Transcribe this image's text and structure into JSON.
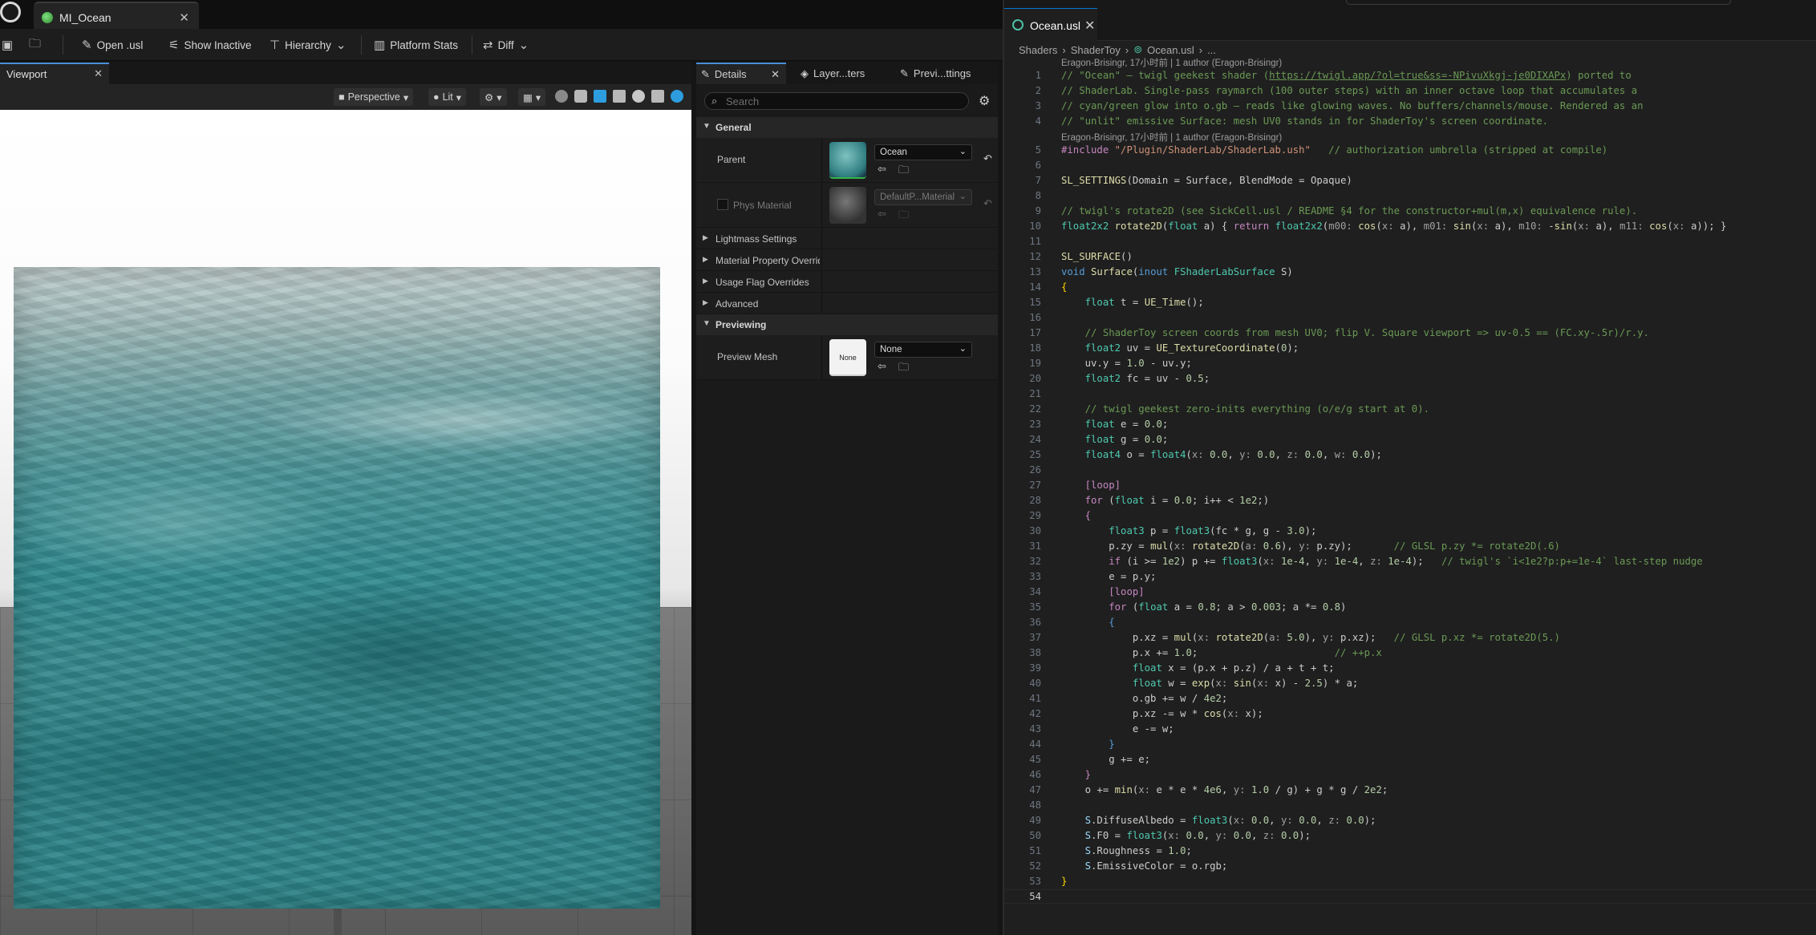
{
  "ue": {
    "asset_tab": "MI_Ocean",
    "toolbar": {
      "open_label": "Open .usl",
      "show_inactive": "Show Inactive",
      "hierarchy": "Hierarchy",
      "platform_stats": "Platform Stats",
      "diff": "Diff"
    },
    "viewport": {
      "tab": "Viewport",
      "perspective": "Perspective",
      "lit": "Lit"
    },
    "details": {
      "tabs": [
        "Details",
        "Layer...ters",
        "Previ...ttings"
      ],
      "search_placeholder": "Search",
      "general": "General",
      "parent_label": "Parent",
      "parent_value": "Ocean",
      "phys_label": "Phys Material",
      "phys_value": "DefaultP...Material",
      "subsections": [
        "Lightmass Settings",
        "Material Property Overrid",
        "Usage Flag Overrides",
        "Advanced"
      ],
      "previewing": "Previewing",
      "preview_mesh_label": "Preview Mesh",
      "preview_thumb": "None",
      "preview_value": "None"
    }
  },
  "vscode": {
    "tab": "Ocean.usl",
    "breadcrumb": [
      "Shaders",
      "ShaderToy",
      "Ocean.usl",
      "..."
    ],
    "blame": "Eragon-Brisingr, 17小时前 | 1 author (Eragon-Brisingr)",
    "blame2": "Eragon-Brisingr, 17小时前 | 1 author (Eragon-Brisingr)",
    "current_line": 54,
    "line_count": 54
  },
  "colors": {
    "accent": "#0078d4",
    "ocean": "#2f8a8f",
    "comment": "#6a9955",
    "keyword": "#569cd6",
    "type": "#4ec9b0"
  }
}
